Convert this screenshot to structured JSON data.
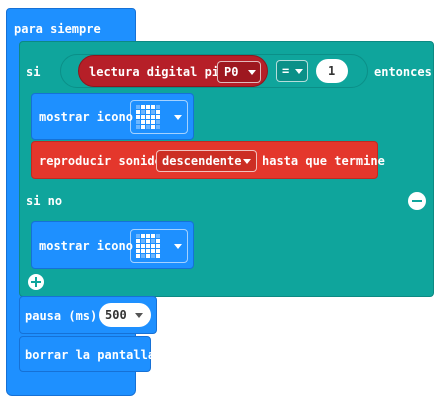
{
  "forever": {
    "label": "para siempre"
  },
  "if_block": {
    "if_label": "si",
    "then_label": "entonces",
    "else_label": "si no",
    "condition": {
      "reporter_label": "lectura digital pin",
      "pin_value": "P0",
      "operator": "=",
      "compare_value": "1"
    },
    "then_show_icon": {
      "label": "mostrar icono",
      "icon_name": "skull-icon",
      "leds": [
        0,
        1,
        1,
        1,
        0,
        1,
        0,
        1,
        0,
        1,
        1,
        1,
        1,
        1,
        1,
        0,
        1,
        1,
        1,
        0,
        0,
        1,
        0,
        1,
        0
      ]
    },
    "play_sound": {
      "label": "reproducir sonido",
      "sound_value": "descendente",
      "suffix": "hasta que termine"
    },
    "else_show_icon": {
      "label": "mostrar icono",
      "icon_name": "pacman-ghost-icon",
      "leds": [
        0,
        1,
        1,
        1,
        0,
        1,
        0,
        1,
        0,
        1,
        1,
        1,
        1,
        1,
        1,
        1,
        1,
        1,
        1,
        1,
        1,
        0,
        1,
        0,
        1
      ]
    }
  },
  "pause": {
    "label": "pausa (ms)",
    "value": "500"
  },
  "clear_screen": {
    "label": "borrar la pantalla"
  },
  "colors": {
    "basic": "#1e90ff",
    "logic": "#0fa59c",
    "music": "#e4372c",
    "pins": "#b61f28"
  }
}
